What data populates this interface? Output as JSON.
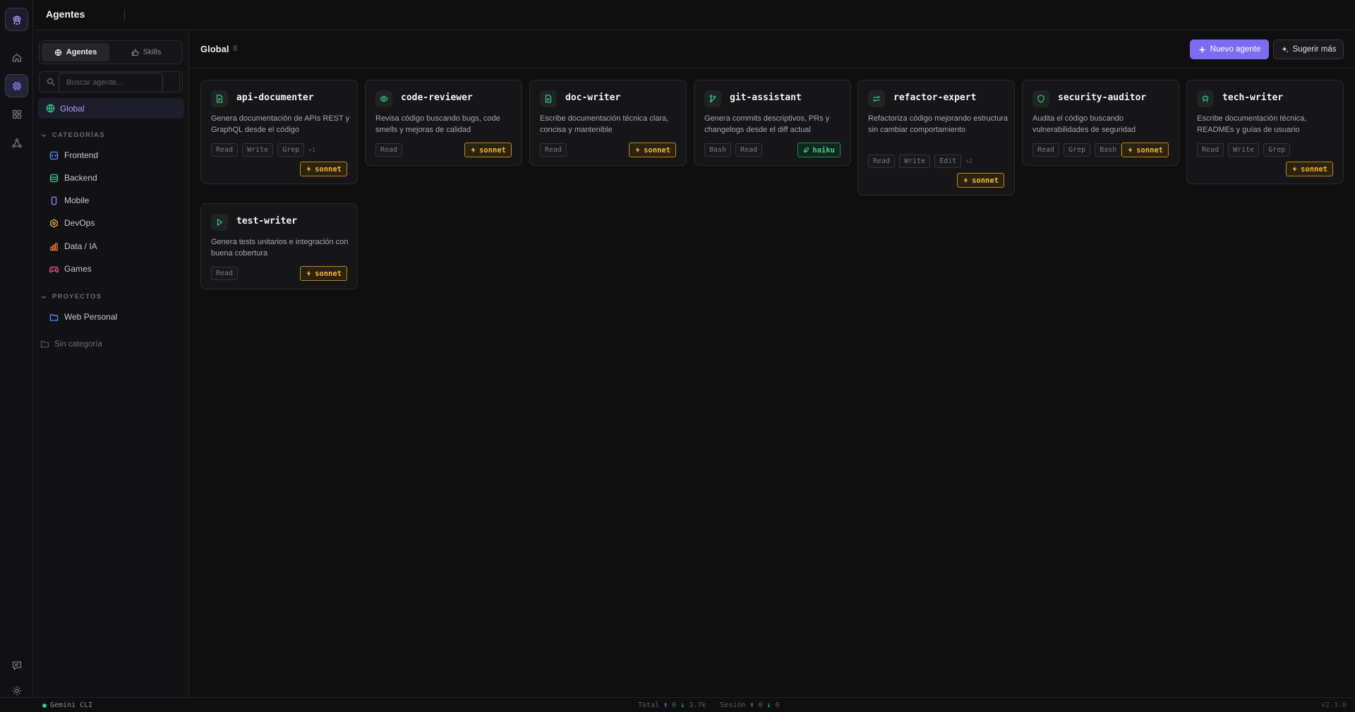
{
  "app": {
    "title": "Agentes"
  },
  "sidebar": {
    "tabs": [
      {
        "label": "Agentes"
      },
      {
        "label": "Skills"
      }
    ],
    "search": {
      "placeholder": "Buscar agente..."
    },
    "global_label": "Global",
    "categories_header": "CATEGORÍAS",
    "categories": [
      {
        "label": "Frontend",
        "icon": "code-icon",
        "color": "#5b8cff"
      },
      {
        "label": "Backend",
        "icon": "server-icon",
        "color": "#36c38a"
      },
      {
        "label": "Mobile",
        "icon": "phone-icon",
        "color": "#a27cf5"
      },
      {
        "label": "DevOps",
        "icon": "hexagon-icon",
        "color": "#f2b63a"
      },
      {
        "label": "Data / IA",
        "icon": "bar-chart-icon",
        "color": "#f27a3a"
      },
      {
        "label": "Games",
        "icon": "gamepad-icon",
        "color": "#f25c9a"
      }
    ],
    "projects_header": "PROYECTOS",
    "projects": [
      {
        "label": "Web Personal",
        "icon": "folder-icon",
        "color": "#5b8cff"
      }
    ],
    "uncategorized_label": "Sin categoría"
  },
  "main": {
    "title": "Global",
    "count": "8",
    "new_button": "Nuevo agente",
    "suggest_button": "Sugerir más"
  },
  "agents": [
    {
      "name": "api-documenter",
      "icon": "file-icon",
      "desc": "Genera documentación de APIs REST y GraphQL desde el código",
      "tools": [
        "Read",
        "Write",
        "Grep"
      ],
      "more": "+1",
      "model": "sonnet"
    },
    {
      "name": "code-reviewer",
      "icon": "eye-icon",
      "desc": "Revisa código buscando bugs, code smells y mejoras de calidad",
      "tools": [
        "Read"
      ],
      "more": "",
      "model": "sonnet"
    },
    {
      "name": "doc-writer",
      "icon": "file-icon",
      "desc": "Escribe documentación técnica clara, concisa y mantenible",
      "tools": [
        "Read"
      ],
      "more": "",
      "model": "sonnet"
    },
    {
      "name": "git-assistant",
      "icon": "git-branch-icon",
      "desc": "Genera commits descriptivos, PRs y changelogs desde el diff actual",
      "tools": [
        "Bash",
        "Read"
      ],
      "more": "",
      "model": "haiku"
    },
    {
      "name": "refactor-expert",
      "icon": "arrows-icon",
      "desc": "Refactoriza código mejorando estructura sin cambiar comportamiento",
      "tools": [
        "Read",
        "Write",
        "Edit"
      ],
      "more": "+2",
      "model": "sonnet"
    },
    {
      "name": "security-auditor",
      "icon": "shield-icon",
      "desc": "Audita el código buscando vulnerabilidades de seguridad",
      "tools": [
        "Read",
        "Grep",
        "Bash"
      ],
      "more": "",
      "model": "sonnet"
    },
    {
      "name": "tech-writer",
      "icon": "robot-icon",
      "desc": "Escribe documentación técnica, READMEs y guías de usuario",
      "tools": [
        "Read",
        "Write",
        "Grep"
      ],
      "more": "",
      "model": "sonnet"
    },
    {
      "name": "test-writer",
      "icon": "play-icon",
      "desc": "Genera tests unitarios e integración con buena cobertura",
      "tools": [
        "Read"
      ],
      "more": "",
      "model": "sonnet"
    }
  ],
  "status": {
    "provider": "Gemini CLI",
    "total_label": "Total",
    "total_up": "0",
    "total_down": "3.7k",
    "session_label": "Sesión",
    "session_up": "0",
    "session_down": "0",
    "version": "v2.3.0"
  },
  "colors": {
    "accent": "#7c6cf0",
    "sonnet": "#f2b63a",
    "haiku": "#3ed08a"
  }
}
